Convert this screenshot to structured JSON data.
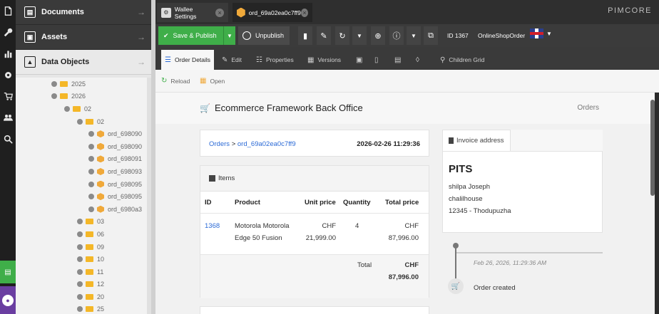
{
  "tree": {
    "accordion": [
      {
        "label": "Documents",
        "active": false
      },
      {
        "label": "Assets",
        "active": false
      },
      {
        "label": "Data Objects",
        "active": true
      }
    ],
    "nodes": [
      {
        "indent": 50,
        "type": "folder",
        "toggle": true,
        "label": "2025"
      },
      {
        "indent": 50,
        "type": "folder",
        "toggle": true,
        "label": "2026"
      },
      {
        "indent": 68,
        "type": "folder",
        "toggle": true,
        "label": "02"
      },
      {
        "indent": 86,
        "type": "folder",
        "toggle": true,
        "label": "02"
      },
      {
        "indent": 102,
        "type": "object",
        "toggle": true,
        "label": "ord_698090"
      },
      {
        "indent": 102,
        "type": "object",
        "toggle": true,
        "label": "ord_698090"
      },
      {
        "indent": 102,
        "type": "object",
        "toggle": true,
        "label": "ord_698091"
      },
      {
        "indent": 102,
        "type": "object",
        "toggle": true,
        "label": "ord_698093"
      },
      {
        "indent": 102,
        "type": "object",
        "toggle": true,
        "label": "ord_698095"
      },
      {
        "indent": 102,
        "type": "object",
        "toggle": true,
        "label": "ord_698095"
      },
      {
        "indent": 102,
        "type": "object",
        "toggle": true,
        "label": "ord_6980a3"
      },
      {
        "indent": 86,
        "type": "folder",
        "toggle": true,
        "label": "03"
      },
      {
        "indent": 86,
        "type": "folder",
        "toggle": true,
        "label": "06"
      },
      {
        "indent": 86,
        "type": "folder",
        "toggle": true,
        "label": "09"
      },
      {
        "indent": 86,
        "type": "folder",
        "toggle": true,
        "label": "10"
      },
      {
        "indent": 86,
        "type": "folder",
        "toggle": true,
        "label": "11"
      },
      {
        "indent": 86,
        "type": "folder",
        "toggle": true,
        "label": "12"
      },
      {
        "indent": 86,
        "type": "folder",
        "toggle": true,
        "label": "20"
      },
      {
        "indent": 86,
        "type": "folder",
        "toggle": true,
        "label": "25"
      }
    ]
  },
  "tabs": [
    {
      "label": "Wallee Settings"
    },
    {
      "label": "ord_69a02ea0c7ff9"
    }
  ],
  "brand": "PIMCORE",
  "toolbar": {
    "save_label": "Save & Publish",
    "unpublish_label": "Unpublish",
    "id_label": "ID 1367",
    "class_label": "OnlineShopOrder"
  },
  "subtabs": [
    {
      "label": "Order Details",
      "icon": "list-icon"
    },
    {
      "label": "Edit",
      "icon": "pencil-icon"
    },
    {
      "label": "Properties",
      "icon": "sliders-icon"
    },
    {
      "label": "Versions",
      "icon": "versions-icon"
    },
    {
      "label": "",
      "icon": "calendar-icon"
    },
    {
      "label": "",
      "icon": "bookmark-icon"
    },
    {
      "label": "",
      "icon": "clipboard-icon"
    },
    {
      "label": "",
      "icon": "tag-icon"
    },
    {
      "label": "Children Grid",
      "icon": "search-icon"
    }
  ],
  "actions": {
    "reload": "Reload",
    "open": "Open"
  },
  "page": {
    "title": "Ecommerce Framework Back Office",
    "orders_link": "Orders"
  },
  "breadcrumb": {
    "orders": "Orders",
    "separator": ">",
    "order_id": "ord_69a02ea0c7ff9",
    "date": "2026-02-26 11:29:36"
  },
  "items": {
    "title": "Items",
    "headers": {
      "id": "ID",
      "product": "Product",
      "unit_price": "Unit price",
      "quantity": "Quantity",
      "total_price": "Total price"
    },
    "rows": [
      {
        "id": "1368",
        "product_line1": "Motorola Motorola",
        "product_line2": "Edge 50 Fusion",
        "unit_currency": "CHF",
        "unit_amount": "21,999.00",
        "quantity": "4",
        "total_currency": "CHF",
        "total_amount": "87,996.00"
      }
    ],
    "total_label": "Total",
    "total_currency": "CHF",
    "total_amount": "87,996.00"
  },
  "invoice": {
    "title": "Invoice address",
    "company": "PITS",
    "name": "shilpa Joseph",
    "street": "chalilhouse",
    "city": "12345 - Thodupuzha"
  },
  "timeline": {
    "date": "Feb 26, 2026, 11:29:36 AM",
    "event": "Order created"
  }
}
